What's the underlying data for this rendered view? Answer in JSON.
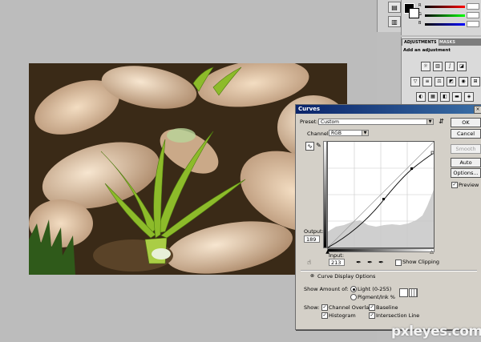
{
  "workspace": {
    "color_panel": {
      "labels": [
        "R",
        "G",
        "B"
      ]
    },
    "adjustments_panel": {
      "tabs": [
        "ADJUSTMENTS",
        "MASKS"
      ],
      "title": "Add an adjustment"
    }
  },
  "curves_dialog": {
    "title": "Curves",
    "preset": {
      "label": "Preset:",
      "value": "Custom"
    },
    "channel": {
      "label": "Channel:",
      "value": "RGB"
    },
    "output": {
      "label": "Output:",
      "value": "189"
    },
    "input": {
      "label": "Input:",
      "value": "213"
    },
    "show_clipping": {
      "label": "Show Clipping",
      "checked": false
    },
    "curve_display_options": "Curve Display Options",
    "show_amount_of": {
      "label": "Show Amount of:",
      "options": [
        {
          "label": "Light  (0-255)",
          "selected": true
        },
        {
          "label": "Pigment/Ink %",
          "selected": false
        }
      ]
    },
    "show": {
      "label": "Show:",
      "items": [
        {
          "label": "Channel Overlays",
          "checked": true
        },
        {
          "label": "Baseline",
          "checked": true
        },
        {
          "label": "Histogram",
          "checked": true
        },
        {
          "label": "Intersection Line",
          "checked": true
        }
      ]
    },
    "buttons": {
      "ok": "OK",
      "cancel": "Cancel",
      "smooth": "Smooth",
      "auto": "Auto",
      "options": "Options..."
    },
    "preview": {
      "label": "Preview",
      "checked": true
    }
  },
  "watermark": "pxleyes.com"
}
